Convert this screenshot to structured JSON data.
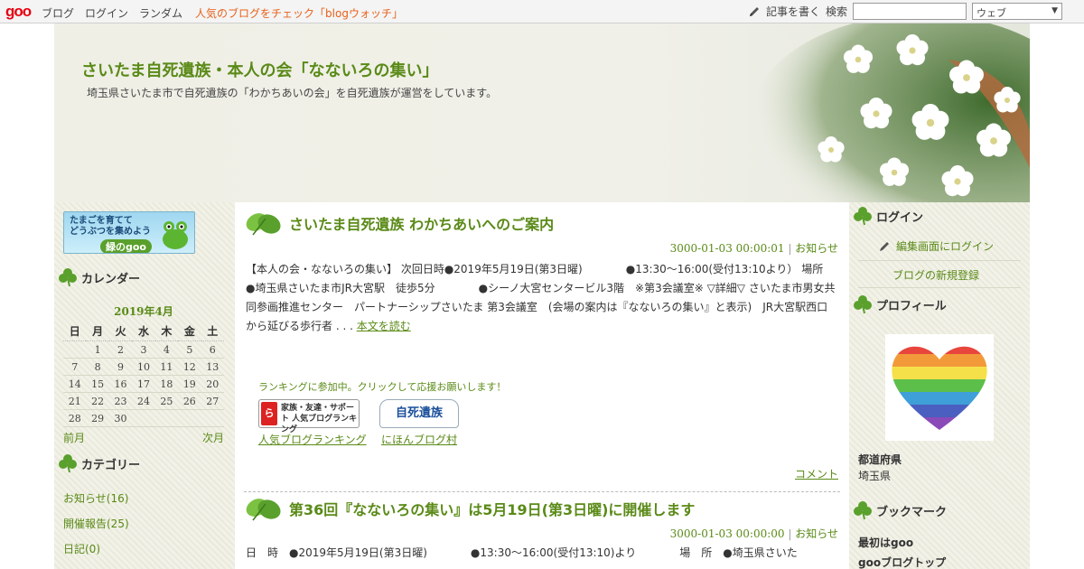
{
  "topbar": {
    "logo": "goo",
    "nav": [
      "ブログ",
      "ログイン",
      "ランダム"
    ],
    "promo": "人気のブログをチェック「blogウォッチ」",
    "write": "記事を書く",
    "search_label": "検索",
    "search_value": "",
    "search_scope": "ウェブ"
  },
  "header": {
    "title": "さいたま自死遺族・本人の会「なないろの集い」",
    "description": "埼玉県さいたま市で自死遺族の「わかちあいの会」を自死遺族が運営をしています。"
  },
  "left": {
    "banner_line1": "たまごを育てて",
    "banner_line2": "どうぶつを集めよう",
    "banner_tag": "緑のgoo",
    "calendar_heading": "カレンダー",
    "calendar_month": "2019年4月",
    "weekdays": [
      "日",
      "月",
      "火",
      "水",
      "木",
      "金",
      "土"
    ],
    "weeks": [
      [
        "",
        "1",
        "2",
        "3",
        "4",
        "5",
        "6"
      ],
      [
        "7",
        "8",
        "9",
        "10",
        "11",
        "12",
        "13"
      ],
      [
        "14",
        "15",
        "16",
        "17",
        "18",
        "19",
        "20"
      ],
      [
        "21",
        "22",
        "23",
        "24",
        "25",
        "26",
        "27"
      ],
      [
        "28",
        "29",
        "30",
        "",
        "",
        "",
        ""
      ]
    ],
    "prev": "前月",
    "next": "次月",
    "category_heading": "カテゴリー",
    "categories": [
      "お知らせ(16)",
      "開催報告(25)",
      "日記(0)"
    ]
  },
  "posts": [
    {
      "title": "さいたま自死遺族 わかちあいへのご案内",
      "date": "3000-01-03 00:00:01",
      "category": "お知らせ",
      "body": "【本人の会・なないろの集い】 次回日時●2019年5月19日(第3日曜)　　　　●13:30～16:00(受付13:10より）  場所　●埼玉県さいたま市JR大宮駅　徒歩5分　　　　●シーノ大宮センタービル3階　※第3会議室※ ▽詳細▽ さいたま市男女共同参画推進センター　パートナーシップさいたま 第3会議室　(会場の案内は『なないろの集い』と表示)　JR大宮駅西口から延びる歩行者 . . . ",
      "more": "本文を読む",
      "ranking_note": "ランキングに参加中。クリックして応援お願いします！",
      "rank1_badge": "家族・友達・サポート 人気ブログランキング",
      "rank2_badge": "自死遺族",
      "rank1_label": "人気ブログランキング",
      "rank2_label": "にほんブログ村",
      "comment": "コメント"
    },
    {
      "title": "第36回『なないろの集い』は5月19日(第3日曜)に開催します",
      "date": "3000-01-03 00:00:00",
      "category": "お知らせ",
      "body": "日　時　●2019年5月19日(第3日曜)　　　　●13:30～16:00(受付13:10)より　　　　場　所　●埼玉県さいた"
    }
  ],
  "right": {
    "login_heading": "ログイン",
    "login_link": "編集画面にログイン",
    "new_blog": "ブログの新規登録",
    "profile_heading": "プロフィール",
    "pref_key": "都道府県",
    "pref_value": "埼玉県",
    "bookmark_heading": "ブックマーク",
    "bookmarks": [
      "最初はgoo",
      "gooブログトップ"
    ]
  }
}
